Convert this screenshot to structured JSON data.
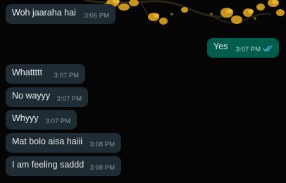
{
  "colors": {
    "background": "#050505",
    "incoming_bubble": "#202c33",
    "outgoing_bubble": "#005c4b",
    "message_text": "#e9edef",
    "timestamp_text": "#8696a0",
    "read_ticks": "#53bdeb",
    "wallpaper_flowers": "#d4a017"
  },
  "messages": [
    {
      "direction": "incoming",
      "text": "Woh jaaraha hai",
      "time": "3:06 PM"
    },
    {
      "direction": "outgoing",
      "text": "Yes",
      "time": "3:07 PM",
      "status_icon": "double-check-read-icon"
    },
    {
      "direction": "incoming",
      "text": "Whattttt",
      "time": "3:07 PM"
    },
    {
      "direction": "incoming",
      "text": "No wayyy",
      "time": "3:07 PM"
    },
    {
      "direction": "incoming",
      "text": "Whyyy",
      "time": "3:07 PM"
    },
    {
      "direction": "incoming",
      "text": "Mat bolo aisa haiii",
      "time": "3:08 PM"
    },
    {
      "direction": "incoming",
      "text": "I am feeling saddd",
      "time": "3:08 PM"
    }
  ]
}
